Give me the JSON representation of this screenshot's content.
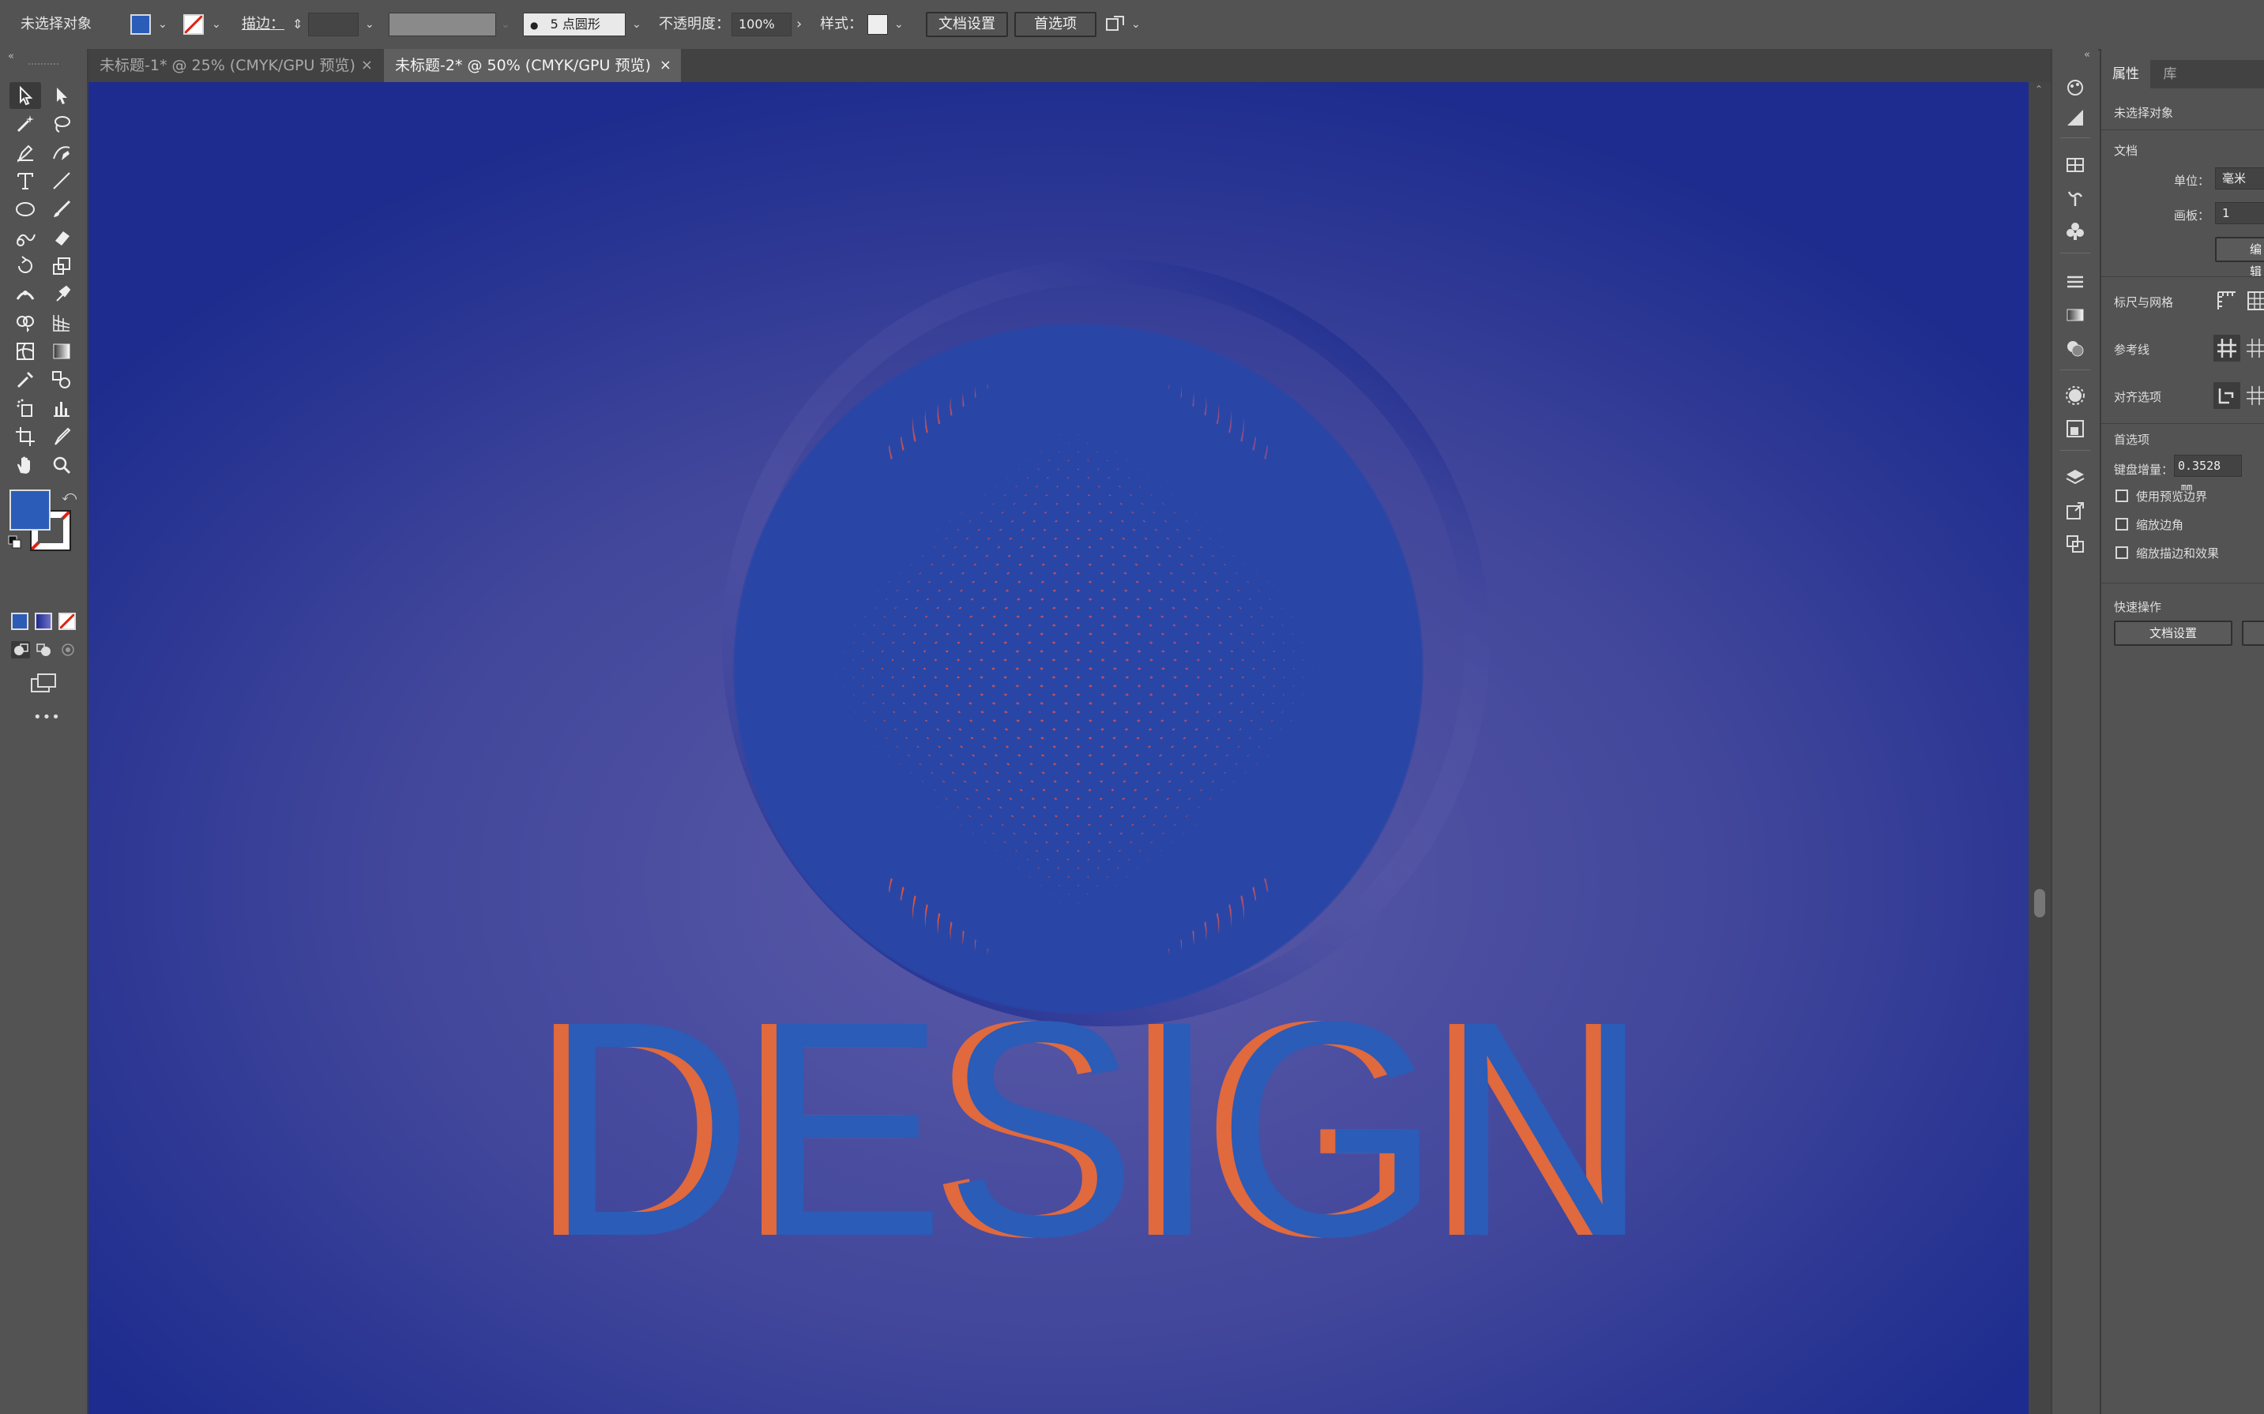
{
  "control_bar": {
    "selection_status": "未选择对象",
    "fill_color": "#2a5cb8",
    "stroke_label": "描边：",
    "brush_label": "5 点圆形",
    "opacity_label": "不透明度：",
    "opacity_value": "100%",
    "style_label": "样式：",
    "doc_setup_button": "文档设置",
    "preferences_button": "首选项"
  },
  "tabs": [
    {
      "label": "未标题-1* @ 25% (CMYK/GPU 预览)",
      "close": "×",
      "active": false
    },
    {
      "label": "未标题-2* @ 50% (CMYK/GPU 预览)",
      "close": "×",
      "active": true
    }
  ],
  "toolbar": {
    "fill_color": "#2a5cb8",
    "more_tools": "•••"
  },
  "artwork": {
    "word": "DESIGN",
    "colors": {
      "bg_center": "#5b5aa8",
      "bg_edge": "#1d2c8e",
      "sphere_orange": "#e8552b",
      "sphere_purple": "#6f4d9c",
      "lattice_blue": "#2946a6",
      "letter_blue": "#2a5cb8",
      "letter_orange": "#e0693e"
    }
  },
  "properties_panel": {
    "tabs": [
      "属性",
      "库"
    ],
    "selection_status": "未选择对象",
    "document_section": "文档",
    "units_label": "单位：",
    "units_value": "毫米",
    "artboard_label": "画板：",
    "artboard_value": "1",
    "edit_artboard_button": "编辑",
    "rulers_grids_label": "标尺与网格",
    "guides_label": "参考线",
    "snap_options_label": "对齐选项",
    "preferences_section": "首选项",
    "keyboard_increment_label": "键盘增量：",
    "keyboard_increment_value": "0.3528",
    "keyboard_increment_unit": "mm",
    "checkboxes": [
      "使用预览边界",
      "缩放边角",
      "缩放描边和效果"
    ],
    "quick_actions_section": "快速操作",
    "doc_setup_button": "文档设置"
  }
}
